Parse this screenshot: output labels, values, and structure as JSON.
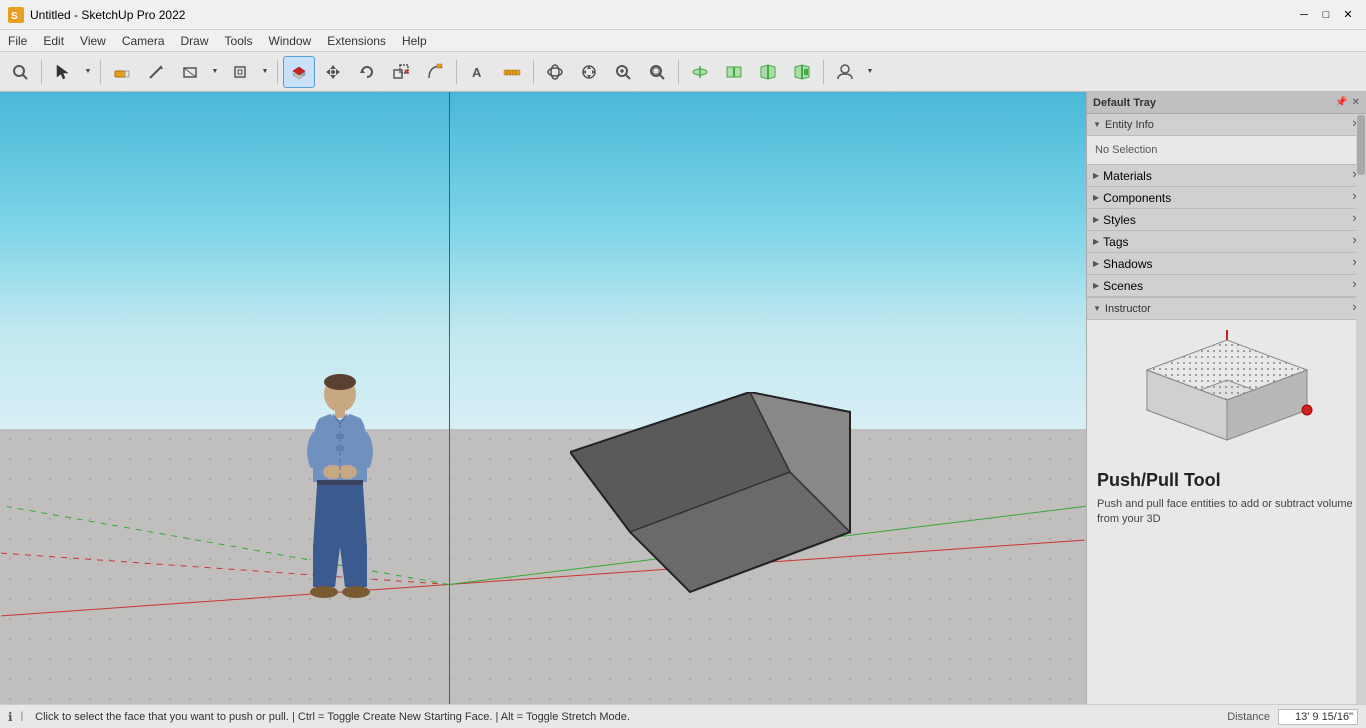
{
  "titlebar": {
    "title": "Untitled - SketchUp Pro 2022",
    "controls": [
      "minimize",
      "maximize",
      "close"
    ]
  },
  "menubar": {
    "items": [
      "File",
      "Edit",
      "View",
      "Camera",
      "Draw",
      "Tools",
      "Window",
      "Extensions",
      "Help"
    ]
  },
  "toolbar": {
    "groups": [
      {
        "tools": [
          "magnify",
          "select",
          "select-dropdown"
        ]
      },
      {
        "tools": [
          "eraser",
          "pencil",
          "shape",
          "shape-dropdown",
          "offset",
          "offset-dropdown"
        ]
      },
      {
        "tools": [
          "pushpull",
          "move",
          "rotate",
          "scale",
          "follow-me"
        ]
      },
      {
        "tools": [
          "text",
          "tape",
          "protractor"
        ]
      },
      {
        "tools": [
          "orbit",
          "pan",
          "zoom",
          "zoom-extents"
        ]
      },
      {
        "tools": [
          "section-plane",
          "section-display",
          "section-cut",
          "section-hybrid"
        ]
      },
      {
        "tools": [
          "account",
          "account-dropdown"
        ]
      }
    ]
  },
  "right_panel": {
    "tray_title": "Default Tray",
    "sections": [
      {
        "id": "entity-info",
        "title": "Entity Info",
        "expanded": true,
        "content": "No Selection"
      },
      {
        "id": "materials",
        "title": "Materials",
        "expanded": false
      },
      {
        "id": "components",
        "title": "Components",
        "expanded": false
      },
      {
        "id": "styles",
        "title": "Styles",
        "expanded": false
      },
      {
        "id": "tags",
        "title": "Tags",
        "expanded": false
      },
      {
        "id": "shadows",
        "title": "Shadows",
        "expanded": false
      },
      {
        "id": "scenes",
        "title": "Scenes",
        "expanded": false
      },
      {
        "id": "instructor",
        "title": "Instructor",
        "expanded": true
      }
    ]
  },
  "instructor": {
    "tool_name": "Push/Pull Tool",
    "tool_description": "Push and pull face entities to add or subtract volume from your 3D"
  },
  "statusbar": {
    "icon": "ℹ",
    "text": "Click to select the face that you want to push or pull. | Ctrl = Toggle Create New Starting Face. | Alt = Toggle Stretch Mode.",
    "distance_label": "Distance",
    "distance_value": "13' 9 15/16\""
  },
  "viewport": {
    "has_person": true,
    "has_shape": true
  }
}
